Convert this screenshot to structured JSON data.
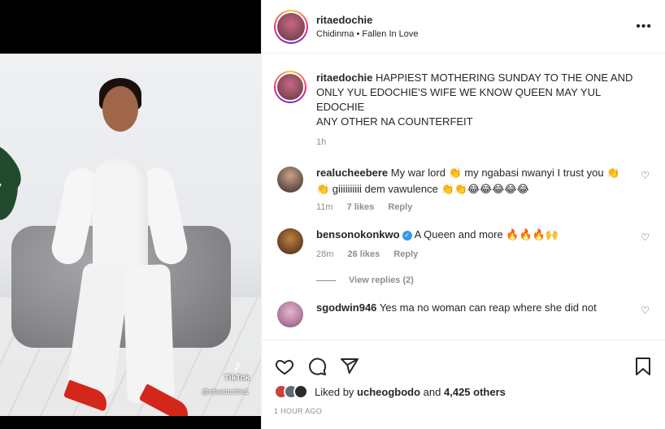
{
  "media": {
    "watermark_brand": "TikTok",
    "watermark_handle": "@ritaedochie1"
  },
  "header": {
    "username": "ritaedochie",
    "audio": "Chidinma • Fallen In Love",
    "more_icon": "more-horizontal-icon"
  },
  "caption": {
    "username": "ritaedochie",
    "text": "HAPPIEST MOTHERING SUNDAY TO THE ONE AND ONLY YUL EDOCHIE'S WIFE WE KNOW QUEEN MAY YUL EDOCHIE\nANY OTHER NA COUNTERFEIT",
    "time": "1h"
  },
  "comments": [
    {
      "username": "realucheebere",
      "text": "My war lord 👏 my ngabasi nwanyi I trust you 👏👏 giiiiiiiiii dem vawulence 👏👏😂😂😂😂😂",
      "time": "11m",
      "likes": "7 likes",
      "reply": "Reply",
      "verified": false
    },
    {
      "username": "bensonokonkwo",
      "text": "A Queen and more 🔥🔥🔥🙌",
      "time": "28m",
      "likes": "26 likes",
      "reply": "Reply",
      "verified": true,
      "view_replies": "View replies (2)"
    },
    {
      "username": "sgodwin946",
      "text": "Yes ma no woman can reap where she did not",
      "verified": false
    }
  ],
  "actions": {
    "like_icon": "heart-icon",
    "comment_icon": "comment-icon",
    "share_icon": "share-icon",
    "save_icon": "bookmark-icon"
  },
  "likes": {
    "prefix": "Liked by",
    "user": "ucheogbodo",
    "conj": "and",
    "others": "4,425 others"
  },
  "timestamp": "1 HOUR AGO"
}
